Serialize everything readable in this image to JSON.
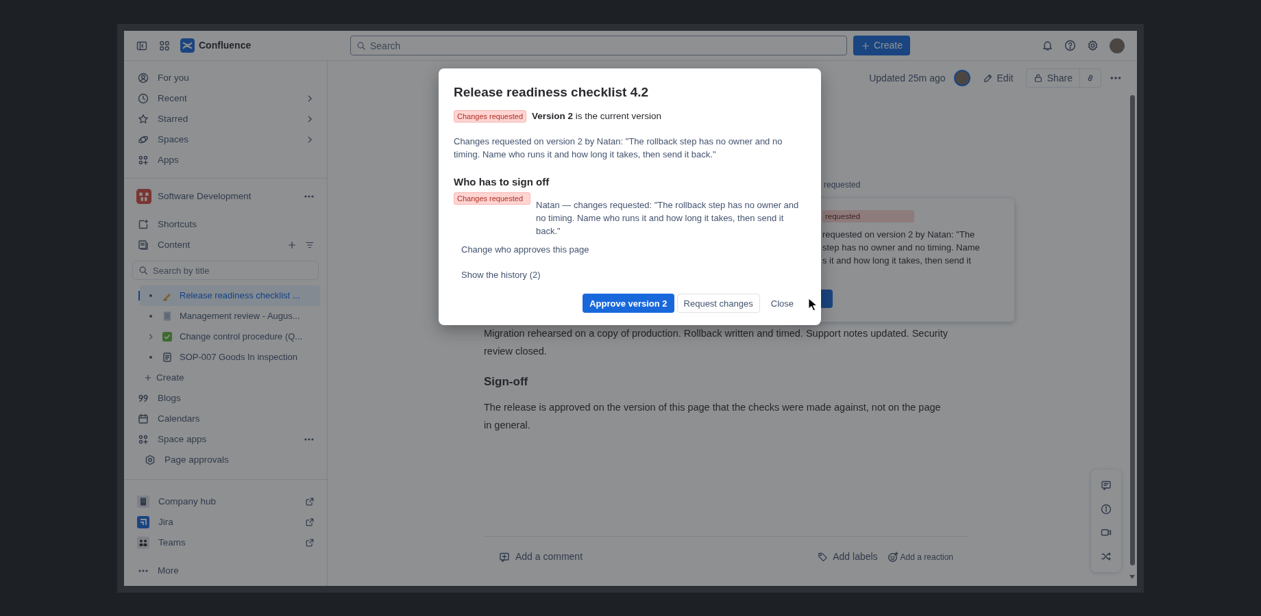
{
  "topbar": {
    "product": "Confluence",
    "search_placeholder": "Search",
    "create_label": "Create"
  },
  "sidebar": {
    "nav": [
      {
        "label": "For you",
        "kind": "link"
      },
      {
        "label": "Recent",
        "kind": "menu"
      },
      {
        "label": "Starred",
        "kind": "menu"
      },
      {
        "label": "Spaces",
        "kind": "menu"
      },
      {
        "label": "Apps",
        "kind": "link"
      }
    ],
    "space": {
      "name": "Software Development"
    },
    "sections": [
      {
        "label": "Shortcuts",
        "kind": "link"
      },
      {
        "label": "Content",
        "kind": "content"
      }
    ],
    "search_placeholder": "Search by title",
    "tree": [
      {
        "title": "Release readiness checklist ...",
        "selected": true,
        "kind": "page"
      },
      {
        "title": "Management review - Augus...",
        "selected": false,
        "kind": "page"
      },
      {
        "title": "Change control procedure (Q...",
        "selected": false,
        "kind": "folder"
      },
      {
        "title": "SOP-007 Goods In inspection",
        "selected": false,
        "kind": "page"
      }
    ],
    "create_label": "Create",
    "space_links": [
      {
        "label": "Blogs",
        "kind": "link"
      },
      {
        "label": "Calendars",
        "kind": "link"
      },
      {
        "label": "Space apps",
        "kind": "more"
      },
      {
        "label": "Page approvals",
        "kind": "subitem"
      }
    ],
    "apps": [
      {
        "label": "Company hub"
      },
      {
        "label": "Jira"
      },
      {
        "label": "Teams"
      }
    ],
    "more_label": "More"
  },
  "page": {
    "updated": "Updated 25m ago",
    "actions": [
      "Edit",
      "Share"
    ],
    "partial_heading": "requested",
    "card": {
      "badge": "requested",
      "lines": [
        "requested on version 2 by Natan: \"The",
        "step has no owner and no timing. Name",
        "s it and how long it takes, then send it"
      ]
    },
    "blocks": [
      {
        "kind": "paragraph",
        "text": "Migration rehearsed on a copy of production. Rollback written and timed. Support notes updated. Security review closed."
      },
      {
        "kind": "heading",
        "text": "Sign-off"
      },
      {
        "kind": "paragraph",
        "text": "The release is approved on the version of this page that the checks were made against, not on the page in general."
      }
    ],
    "footer": {
      "comment": "Add a comment",
      "labels": "Add labels",
      "reaction": "Add a reaction"
    }
  },
  "dialog": {
    "title": "Release readiness checklist 4.2",
    "status": "Changes requested",
    "version_line": "**Version 2** is the current version",
    "message": "Changes requested on version 2 by Natan: \"The rollback step has no owner and no timing. Name who runs it and how long it takes, then send it back.\"",
    "signoff_heading": "Who has to sign off",
    "approvers": [
      {
        "status": "Changes requested",
        "text": "Natan — changes requested: \"The rollback step has no owner and no timing. Name who runs it and how long it takes, then send it back.\""
      }
    ],
    "links": [
      "Change who approves this page",
      "Show the history (2)"
    ],
    "buttons": [
      {
        "label": "Approve version 2",
        "kind": "primary"
      },
      {
        "label": "Request changes",
        "kind": "default"
      },
      {
        "label": "Close",
        "kind": "subtle"
      }
    ]
  }
}
